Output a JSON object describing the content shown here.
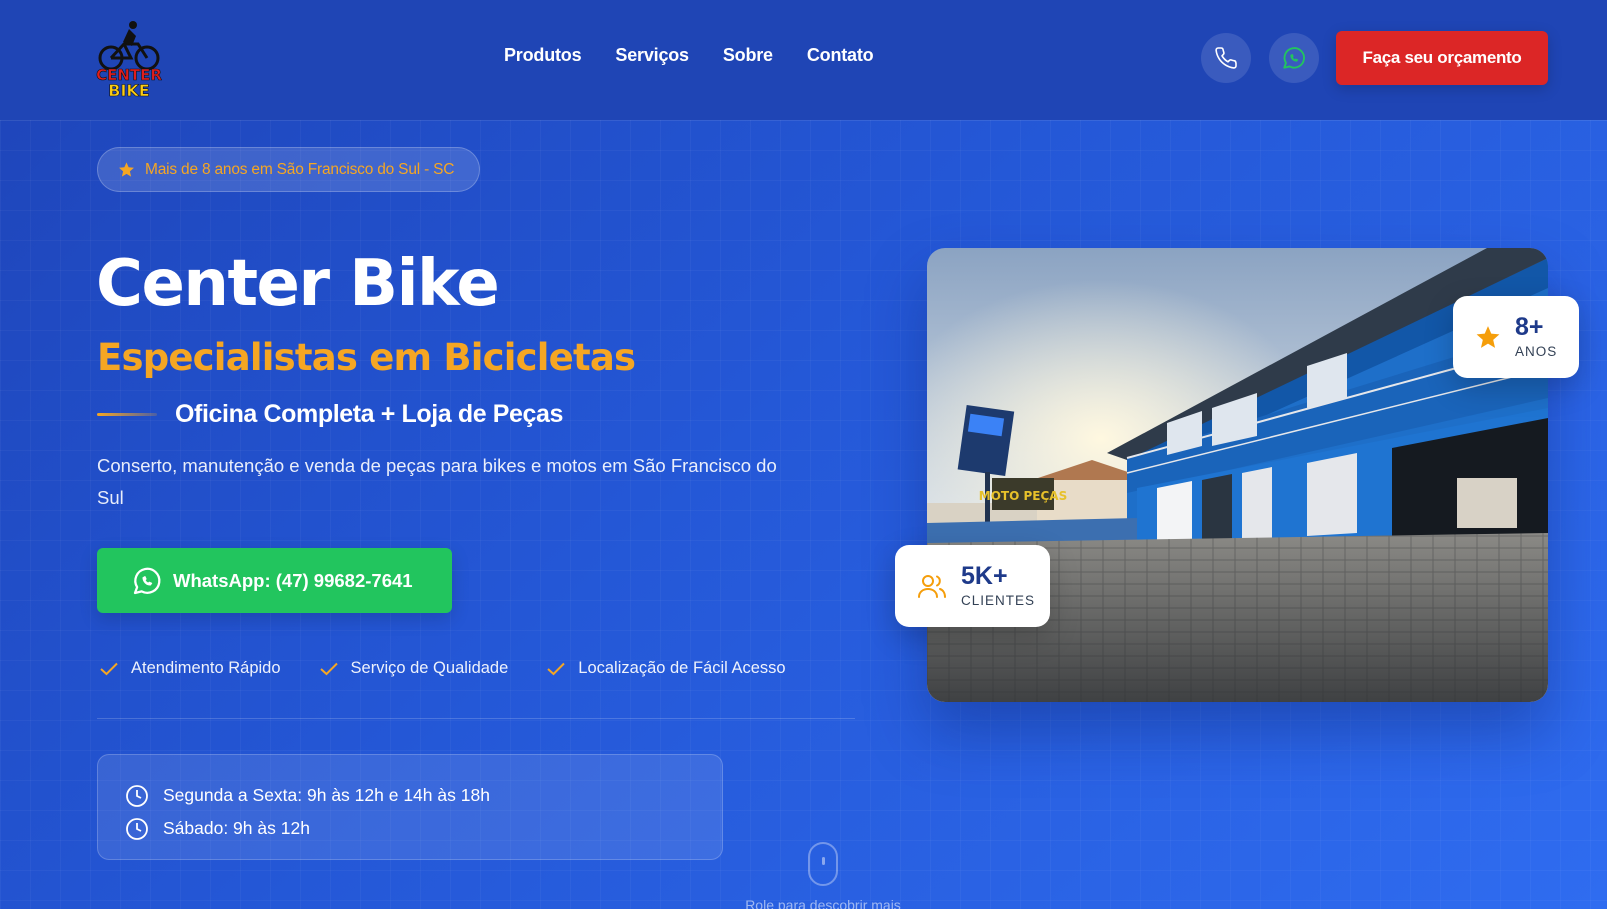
{
  "brand": {
    "logo_text_top": "CENTER",
    "logo_text_bottom": "BIKE"
  },
  "nav": {
    "items": [
      {
        "label": "Produtos"
      },
      {
        "label": "Serviços"
      },
      {
        "label": "Sobre"
      },
      {
        "label": "Contato"
      }
    ]
  },
  "header": {
    "phone_icon": "phone-icon",
    "whatsapp_icon": "whatsapp-icon",
    "cta_label": "Faça seu orçamento"
  },
  "hero": {
    "badge": "Mais de 8 anos em São Francisco do Sul - SC",
    "title": "Center Bike",
    "subtitle": "Especialistas em Bicicletas",
    "tagline": "Oficina Completa + Loja de Peças",
    "description": "Conserto, manutenção e venda de peças para bikes e motos em São Francisco do Sul",
    "whatsapp_cta": "WhatsApp: (47) 99682-7641",
    "features": [
      {
        "label": "Atendimento Rápido"
      },
      {
        "label": "Serviço de Qualidade"
      },
      {
        "label": "Localização de Fácil Acesso"
      }
    ],
    "hours": [
      {
        "label": "Segunda a Sexta: 9h às 12h e 14h às 18h"
      },
      {
        "label": "Sábado: 9h às 12h"
      }
    ]
  },
  "stats": {
    "years_value": "8+",
    "years_label": "ANOS",
    "clients_value": "5K+",
    "clients_label": "CLIENTES"
  },
  "photo": {
    "sign_text": "MOTO PEÇAS"
  },
  "scroll_hint": "Role para descobrir mais",
  "colors": {
    "accent": "#f5a623",
    "cta_red": "#dc2626",
    "whatsapp_green": "#22c55e",
    "header_blue": "#1f45b5"
  }
}
